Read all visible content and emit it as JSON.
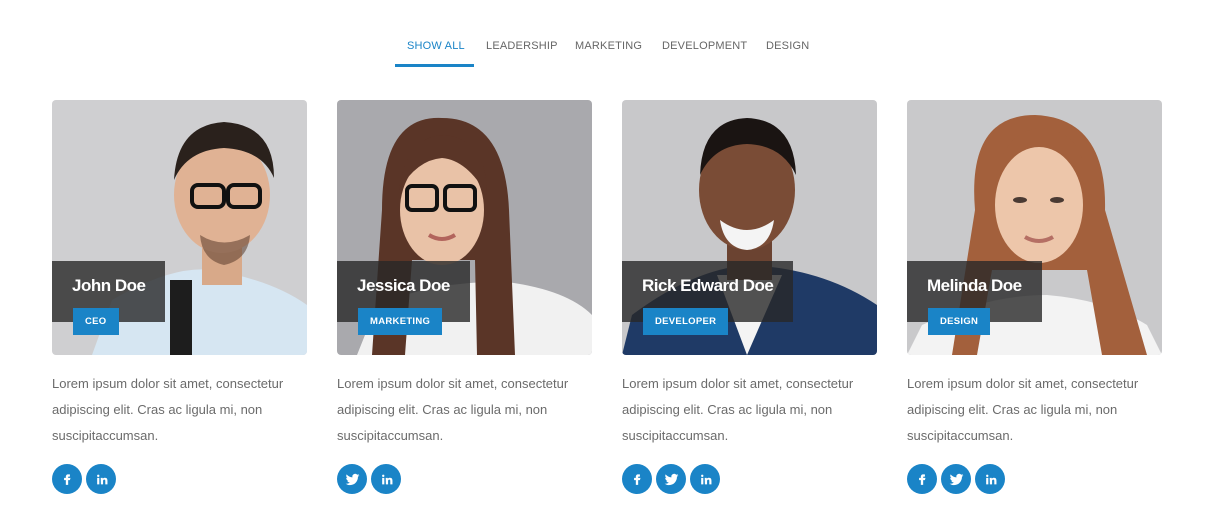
{
  "filters": [
    {
      "label": "SHOW ALL",
      "active": true
    },
    {
      "label": "LEADERSHIP",
      "active": false
    },
    {
      "label": "MARKETING",
      "active": false
    },
    {
      "label": "DEVELOPMENT",
      "active": false
    },
    {
      "label": "DESIGN",
      "active": false
    }
  ],
  "accent_color": "#1a84c7",
  "team": [
    {
      "name": "John Doe",
      "role": "CEO",
      "description": "Lorem ipsum dolor sit amet, consectetur adipiscing elit. Cras ac ligula mi, non suscipitaccumsan.",
      "socials": [
        "facebook-icon",
        "linkedin-icon"
      ]
    },
    {
      "name": "Jessica Doe",
      "role": "MARKETING",
      "description": "Lorem ipsum dolor sit amet, consectetur adipiscing elit. Cras ac ligula mi, non suscipitaccumsan.",
      "socials": [
        "twitter-icon",
        "linkedin-icon"
      ]
    },
    {
      "name": "Rick Edward Doe",
      "role": "DEVELOPER",
      "description": "Lorem ipsum dolor sit amet, consectetur adipiscing elit. Cras ac ligula mi, non suscipitaccumsan.",
      "socials": [
        "facebook-icon",
        "twitter-icon",
        "linkedin-icon"
      ]
    },
    {
      "name": "Melinda Doe",
      "role": "DESIGN",
      "description": "Lorem ipsum dolor sit amet, consectetur adipiscing elit. Cras ac ligula mi, non suscipitaccumsan.",
      "socials": [
        "facebook-icon",
        "twitter-icon",
        "linkedin-icon"
      ]
    }
  ]
}
